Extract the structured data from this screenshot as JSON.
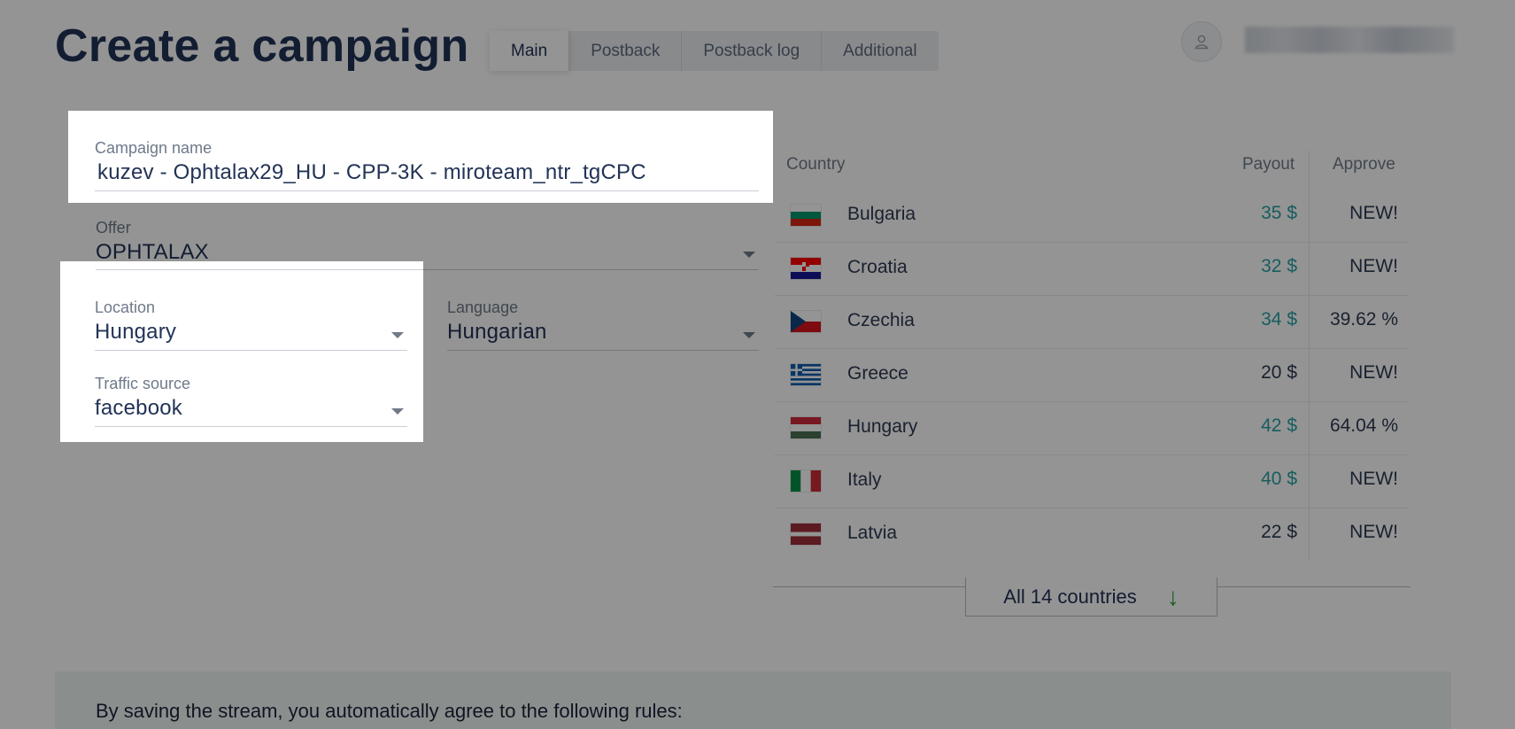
{
  "header": {
    "title": "Create a campaign",
    "tabs": [
      {
        "label": "Main",
        "active": true
      },
      {
        "label": "Postback",
        "active": false
      },
      {
        "label": "Postback log",
        "active": false
      },
      {
        "label": "Additional",
        "active": false
      }
    ],
    "user_icon": "user-icon"
  },
  "form": {
    "campaign_name": {
      "label": "Campaign name",
      "value": "kuzev - Ophtalax29_HU - CPP-3K - miroteam_ntr_tgCPC"
    },
    "offer": {
      "label": "Offer",
      "value": "OPHTALAX"
    },
    "location": {
      "label": "Location",
      "value": "Hungary"
    },
    "language": {
      "label": "Language",
      "value": "Hungarian"
    },
    "traffic_source": {
      "label": "Traffic source",
      "value": "facebook"
    }
  },
  "countries_table": {
    "headers": {
      "country": "Country",
      "payout": "Payout",
      "approve": "Approve"
    },
    "rows": [
      {
        "country": "Bulgaria",
        "flag": "bulgaria-flag",
        "payout": "35 $",
        "payout_highlight": true,
        "approve": "NEW!"
      },
      {
        "country": "Croatia",
        "flag": "croatia-flag",
        "payout": "32 $",
        "payout_highlight": true,
        "approve": "NEW!"
      },
      {
        "country": "Czechia",
        "flag": "czechia-flag",
        "payout": "34 $",
        "payout_highlight": true,
        "approve": "39.62 %"
      },
      {
        "country": "Greece",
        "flag": "greece-flag",
        "payout": "20 $",
        "payout_highlight": false,
        "approve": "NEW!"
      },
      {
        "country": "Hungary",
        "flag": "hungary-flag",
        "payout": "42 $",
        "payout_highlight": true,
        "approve": "64.04 %"
      },
      {
        "country": "Italy",
        "flag": "italy-flag",
        "payout": "40 $",
        "payout_highlight": true,
        "approve": "NEW!"
      },
      {
        "country": "Latvia",
        "flag": "latvia-flag",
        "payout": "22 $",
        "payout_highlight": false,
        "approve": "NEW!"
      }
    ],
    "all_countries_label": "All 14 countries",
    "arrow_icon": "arrow-down-icon"
  },
  "rules": {
    "text": "By saving the stream, you automatically agree to the following rules:"
  },
  "colors": {
    "title": "#223356",
    "payout_highlight": "#2aa0a6",
    "payout_normal": "#2d3a52",
    "arrow": "#2f9e3c",
    "dim_overlay": "rgba(0,0,0,0.42)"
  }
}
